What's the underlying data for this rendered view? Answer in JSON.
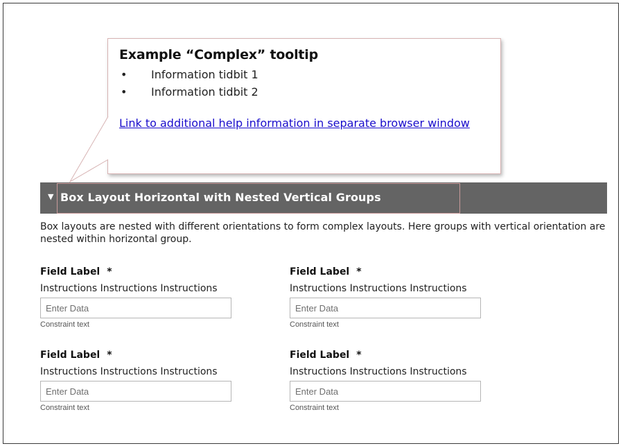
{
  "tooltip": {
    "title": "Example “Complex” tooltip",
    "bullet_glyph": "•",
    "items": [
      "Information tidbit 1",
      "Information tidbit 2"
    ],
    "link_text": "Link to additional help information in separate browser window"
  },
  "section": {
    "expand_indicator": "▼",
    "title": "Box Layout Horizontal with Nested Vertical Groups",
    "description": "Box layouts are nested with different orientations to form complex layouts. Here groups with vertical orientation are nested within horizontal group."
  },
  "fields": [
    {
      "label": "Field Label",
      "required_marker": "*",
      "instructions": "Instructions Instructions Instructions",
      "placeholder": "Enter Data",
      "constraint": "Constraint text"
    },
    {
      "label": "Field Label",
      "required_marker": "*",
      "instructions": "Instructions Instructions Instructions",
      "placeholder": "Enter Data",
      "constraint": "Constraint text"
    },
    {
      "label": "Field Label",
      "required_marker": "*",
      "instructions": "Instructions Instructions Instructions",
      "placeholder": "Enter Data",
      "constraint": "Constraint text"
    },
    {
      "label": "Field Label",
      "required_marker": "*",
      "instructions": "Instructions Instructions Instructions",
      "placeholder": "Enter Data",
      "constraint": "Constraint text"
    }
  ],
  "colors": {
    "header_background": "#646464",
    "link": "#1a0dcc",
    "tooltip_border": "#d7b3b3"
  }
}
